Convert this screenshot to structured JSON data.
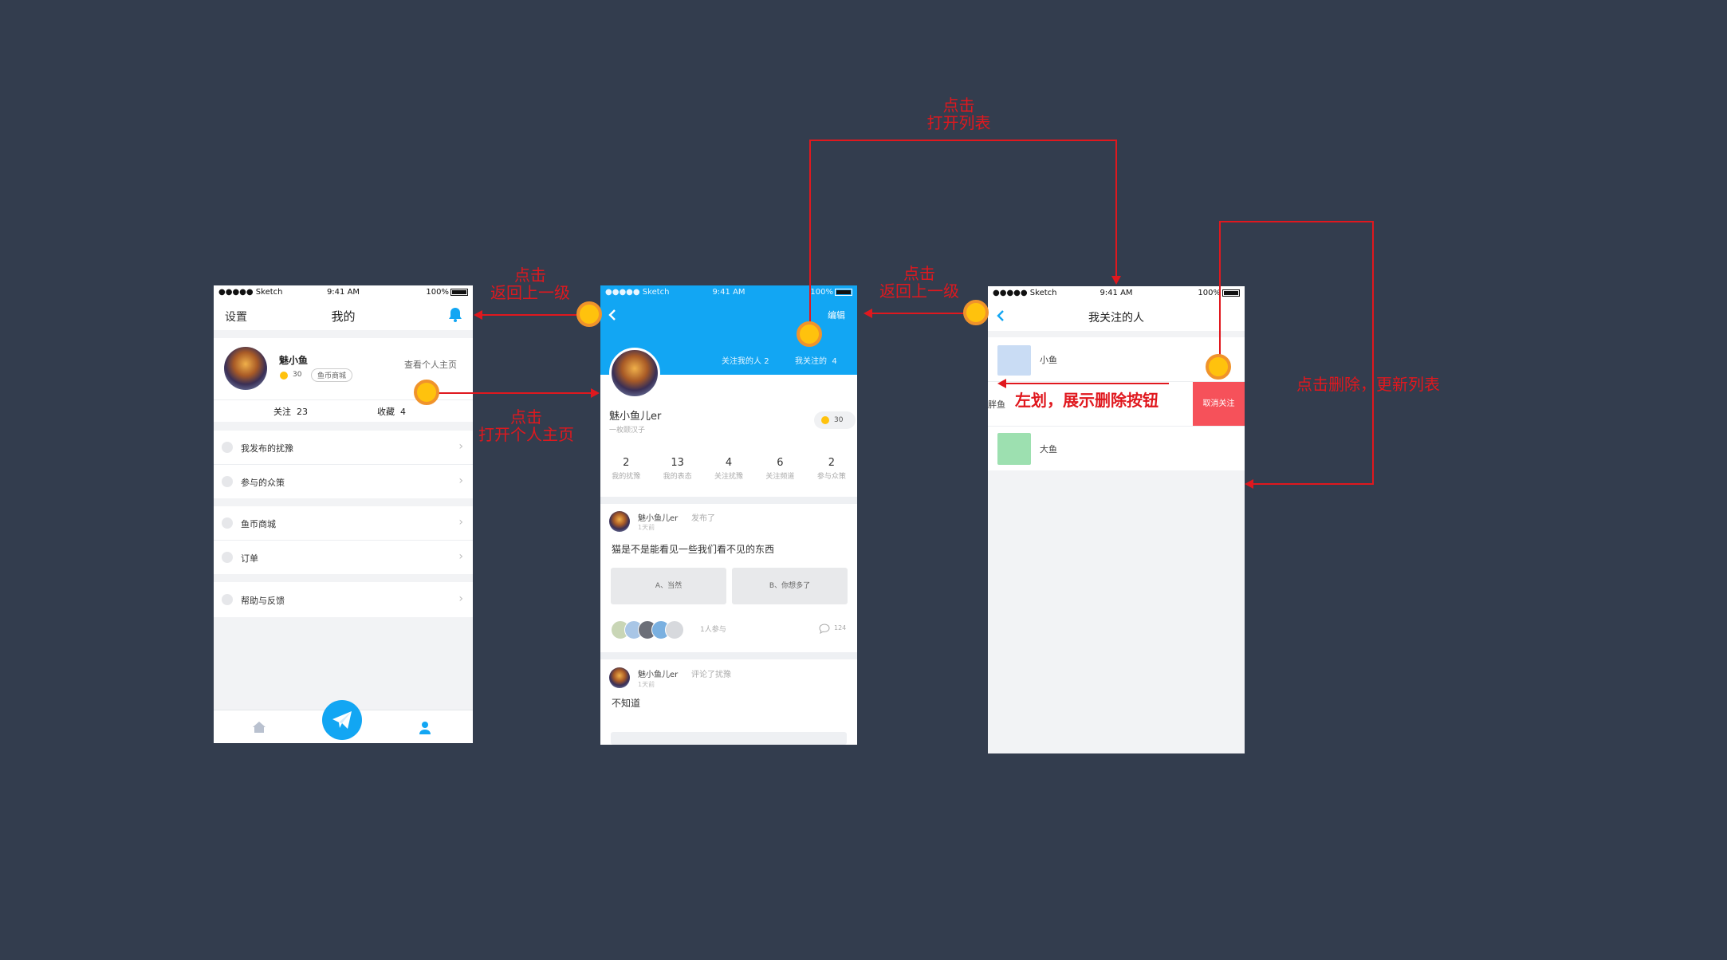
{
  "status_bar": {
    "carrier": "●●●●● Sketch",
    "time": "9:41 AM",
    "battery": "100%"
  },
  "screen1": {
    "nav_left": "设置",
    "nav_title": "我的",
    "user_name": "魅小鱼",
    "coins": "30",
    "shop_badge": "鱼币商城",
    "view_profile": "查看个人主页",
    "follow_label": "关注",
    "follow_count": "23",
    "collect_label": "收藏",
    "collect_count": "4",
    "menu": [
      "我发布的扰豫",
      "参与的众策",
      "鱼币商城",
      "订单",
      "帮助与反馈"
    ]
  },
  "screen2": {
    "edit": "编辑",
    "followers_label": "关注我的人",
    "followers_count": "2",
    "following_label": "我关注的",
    "following_count": "4",
    "name": "魅小鱼儿er",
    "bio": "一枚颐汉子",
    "coins": "30",
    "stats": [
      {
        "value": "2",
        "label": "我的扰豫"
      },
      {
        "value": "13",
        "label": "我的表态"
      },
      {
        "value": "4",
        "label": "关注扰豫"
      },
      {
        "value": "6",
        "label": "关注频道"
      },
      {
        "value": "2",
        "label": "参与众策"
      }
    ],
    "post1": {
      "author": "魅小鱼儿er",
      "action": "发布了",
      "time": "1天前",
      "text": "猫是不是能看见一些我们看不见的东西",
      "option_a": "A、当然",
      "option_b": "B、你想多了",
      "participants": "1人参与",
      "comments": "124"
    },
    "post2": {
      "author": "魅小鱼儿er",
      "action": "评论了扰豫",
      "time": "1天前",
      "text": "不知道"
    }
  },
  "screen3": {
    "title": "我关注的人",
    "items": [
      "小鱼",
      "胖鱼",
      "大鱼"
    ],
    "unfollow": "取消关注",
    "swipe_hint": "左划，展示删除按钮"
  },
  "annotations": {
    "back1_line1": "点击",
    "back1_line2": "返回上一级",
    "open_profile_line1": "点击",
    "open_profile_line2": "打开个人主页",
    "back2_line1": "点击",
    "back2_line2": "返回上一级",
    "open_list_line1": "点击",
    "open_list_line2": "打开列表",
    "delete_refresh": "点击删除，更新列表"
  },
  "colors": {
    "background": "#333d4e",
    "accent_blue": "#12a6f3",
    "annotation_red": "#e0181e",
    "touch_yellow": "#ffc20d",
    "delete_red": "#f6515a"
  }
}
